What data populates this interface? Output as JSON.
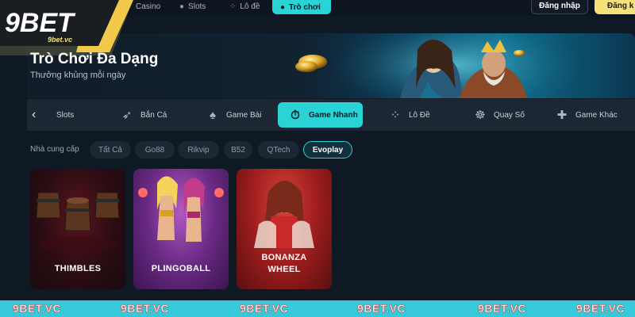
{
  "brand": {
    "logo_text": "9BET",
    "logo_subtext": "9bet.vc",
    "colors": {
      "accent": "#2ad3d6",
      "gold": "#f7e27a",
      "bg": "#0f1923"
    }
  },
  "topnav": {
    "items": [
      {
        "label": "Casino",
        "icon": "casino-icon"
      },
      {
        "label": "Slots",
        "icon": "slots-icon"
      },
      {
        "label": "Lô đề",
        "icon": "lottery-icon"
      },
      {
        "label": "Trò chơi",
        "icon": "game-icon",
        "active": true
      }
    ],
    "login_label": "Đăng nhập",
    "register_label": "Đăng k"
  },
  "banner": {
    "title": "Trò Chơi Đa Dạng",
    "subtitle": "Thưởng khủng mỗi ngày"
  },
  "categories": {
    "items": [
      {
        "label": "Slots",
        "icon": "chevron-left-icon"
      },
      {
        "label": "Bắn Cá",
        "icon": "fish-icon"
      },
      {
        "label": "Game Bài",
        "icon": "cards-icon"
      },
      {
        "label": "Game Nhanh",
        "icon": "stopwatch-icon",
        "active": true
      },
      {
        "label": "Lô Đề",
        "icon": "lottery-balls-icon"
      },
      {
        "label": "Quay Số",
        "icon": "wheel-icon"
      },
      {
        "label": "Game Khác",
        "icon": "puzzle-icon"
      }
    ]
  },
  "providers": {
    "label": "Nhà cung cấp",
    "items": [
      "Tất Cả",
      "Go88",
      "Rikvip",
      "B52",
      "QTech",
      "Evoplay"
    ],
    "selected": "Evoplay"
  },
  "games": [
    {
      "title": "THIMBLES"
    },
    {
      "title": "PLINGOBALL"
    },
    {
      "title_line1": "BONANZA",
      "title_line2": "WHEEL"
    }
  ],
  "watermark": [
    "9BET.VC",
    "9BET.VC",
    "9BET.VC",
    "9BET.VC",
    "9BET.VC",
    "9BET.VC"
  ]
}
